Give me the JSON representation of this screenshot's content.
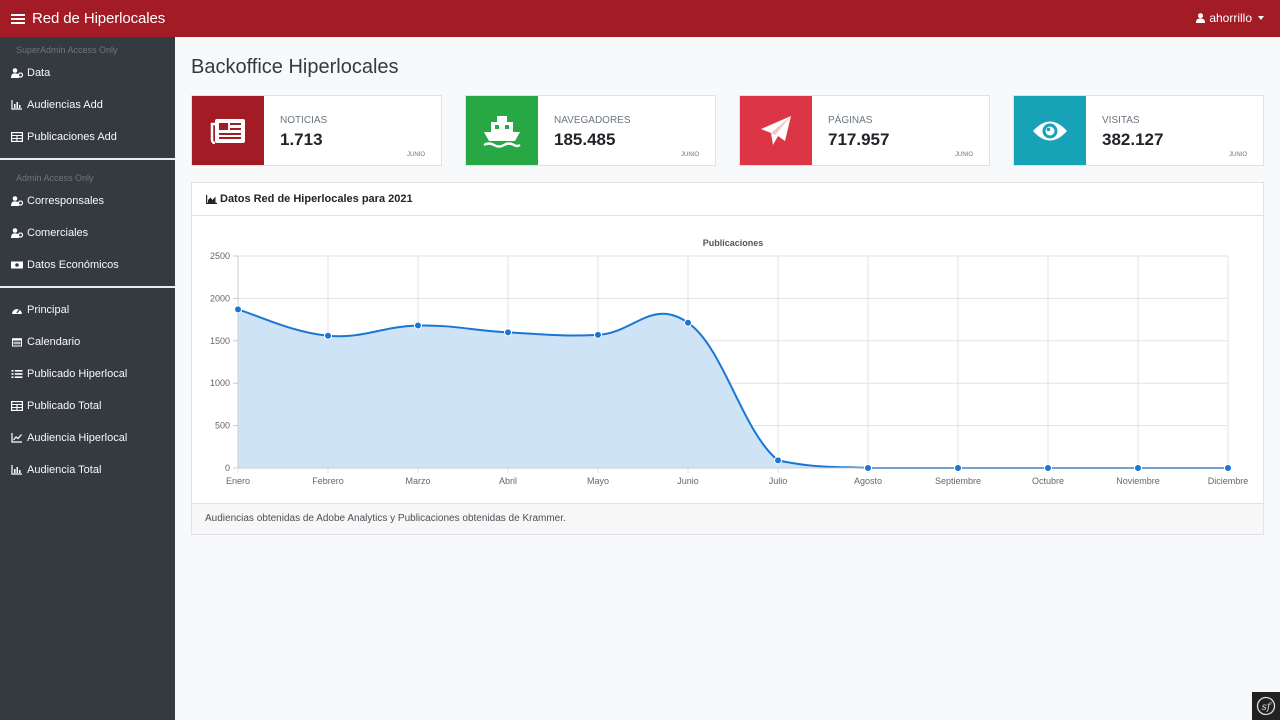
{
  "navbar": {
    "brand": "Red de Hiperlocales",
    "user": "ahorrillo"
  },
  "sidebar": {
    "sections": [
      {
        "heading": "SuperAdmin Access Only",
        "items": [
          {
            "label": "Data",
            "icon": "user-cog-icon"
          },
          {
            "label": "Audiencias Add",
            "icon": "bar-chart-icon"
          },
          {
            "label": "Publicaciones Add",
            "icon": "table-icon"
          }
        ]
      },
      {
        "heading": "Admin Access Only",
        "items": [
          {
            "label": "Corresponsales",
            "icon": "user-cog-icon"
          },
          {
            "label": "Comerciales",
            "icon": "user-cog-icon"
          },
          {
            "label": "Datos Económicos",
            "icon": "money-icon"
          }
        ]
      },
      {
        "heading": "",
        "items": [
          {
            "label": "Principal",
            "icon": "dashboard-icon"
          },
          {
            "label": "Calendario",
            "icon": "calendar-icon"
          },
          {
            "label": "Publicado Hiperlocal",
            "icon": "list-icon"
          },
          {
            "label": "Publicado Total",
            "icon": "table-icon"
          },
          {
            "label": "Audiencia Hiperlocal",
            "icon": "line-chart-icon"
          },
          {
            "label": "Audiencia Total",
            "icon": "bar-chart-icon"
          }
        ]
      }
    ]
  },
  "page": {
    "title": "Backoffice Hiperlocales"
  },
  "stats": [
    {
      "label": "NOTICIAS",
      "value": "1.713",
      "period": "JUNIO",
      "color": "#a31b25",
      "icon": "newspaper-icon"
    },
    {
      "label": "NAVEGADORES",
      "value": "185.485",
      "period": "JUNIO",
      "color": "#28a745",
      "icon": "ship-icon"
    },
    {
      "label": "PÁGINAS",
      "value": "717.957",
      "period": "JUNIO",
      "color": "#dc3545",
      "icon": "paper-plane-icon"
    },
    {
      "label": "VISITAS",
      "value": "382.127",
      "period": "JUNIO",
      "color": "#17a2b8",
      "icon": "eye-icon"
    }
  ],
  "card": {
    "title": "Datos Red de Hiperlocales para 2021",
    "footer": "Audiencias obtenidas de Adobe Analytics y Publicaciones obtenidas de Krammer."
  },
  "chart_data": {
    "type": "area",
    "title": "Publicaciones",
    "categories": [
      "Enero",
      "Febrero",
      "Marzo",
      "Abril",
      "Mayo",
      "Junio",
      "Julio",
      "Agosto",
      "Septiembre",
      "Octubre",
      "Noviembre",
      "Diciembre"
    ],
    "series": [
      {
        "values": [
          1870,
          1560,
          1680,
          1600,
          1570,
          1713,
          90,
          0,
          0,
          0,
          0,
          0
        ],
        "color": "#1976d2",
        "fill": "#cfe3f7"
      }
    ],
    "yticks": [
      0,
      500,
      1000,
      1500,
      2000,
      2500
    ],
    "ylim": [
      0,
      2500
    ],
    "grid": true
  },
  "footer_badge": "sf"
}
